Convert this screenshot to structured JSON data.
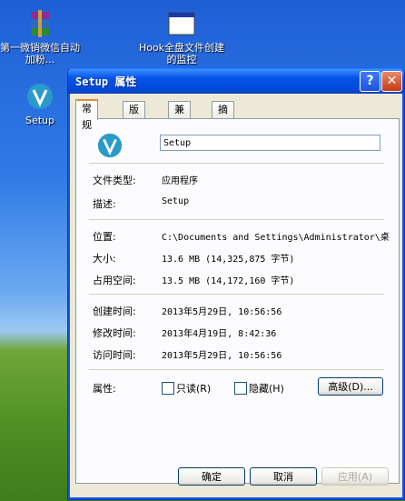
{
  "desktop": {
    "icons": [
      {
        "label": "第一微销微信自动加粉...",
        "icon": "winrar-archive-icon"
      },
      {
        "label": "Hook全盘文件创建的监控",
        "icon": "application-window-icon"
      },
      {
        "label": "Setup",
        "icon": "setup-app-icon"
      }
    ]
  },
  "window": {
    "title": "Setup 属性",
    "help_label": "?",
    "close_label": "✕"
  },
  "tabs": [
    "常规",
    "版本",
    "兼容性",
    "摘要"
  ],
  "general": {
    "file_name": "Setup",
    "file_type_label": "文件类型:",
    "file_type_value": "应用程序",
    "description_label": "描述:",
    "description_value": "Setup",
    "location_label": "位置:",
    "location_value": "C:\\Documents and Settings\\Administrator\\桌",
    "size_label": "大小:",
    "size_value": "13.6 MB (14,325,875 字节)",
    "disk_size_label": "占用空间:",
    "disk_size_value": "13.5 MB (14,172,160 字节)",
    "created_label": "创建时间:",
    "created_value": "2013年5月29日, 10:56:56",
    "modified_label": "修改时间:",
    "modified_value": "2013年4月19日, 8:42:36",
    "accessed_label": "访问时间:",
    "accessed_value": "2013年5月29日, 10:56:56",
    "attributes_label": "属性:",
    "readonly_label": "只读(R)",
    "hidden_label": "隐藏(H)",
    "advanced_label": "高级(D)..."
  },
  "buttons": {
    "ok": "确定",
    "cancel": "取消",
    "apply": "应用(A)"
  }
}
